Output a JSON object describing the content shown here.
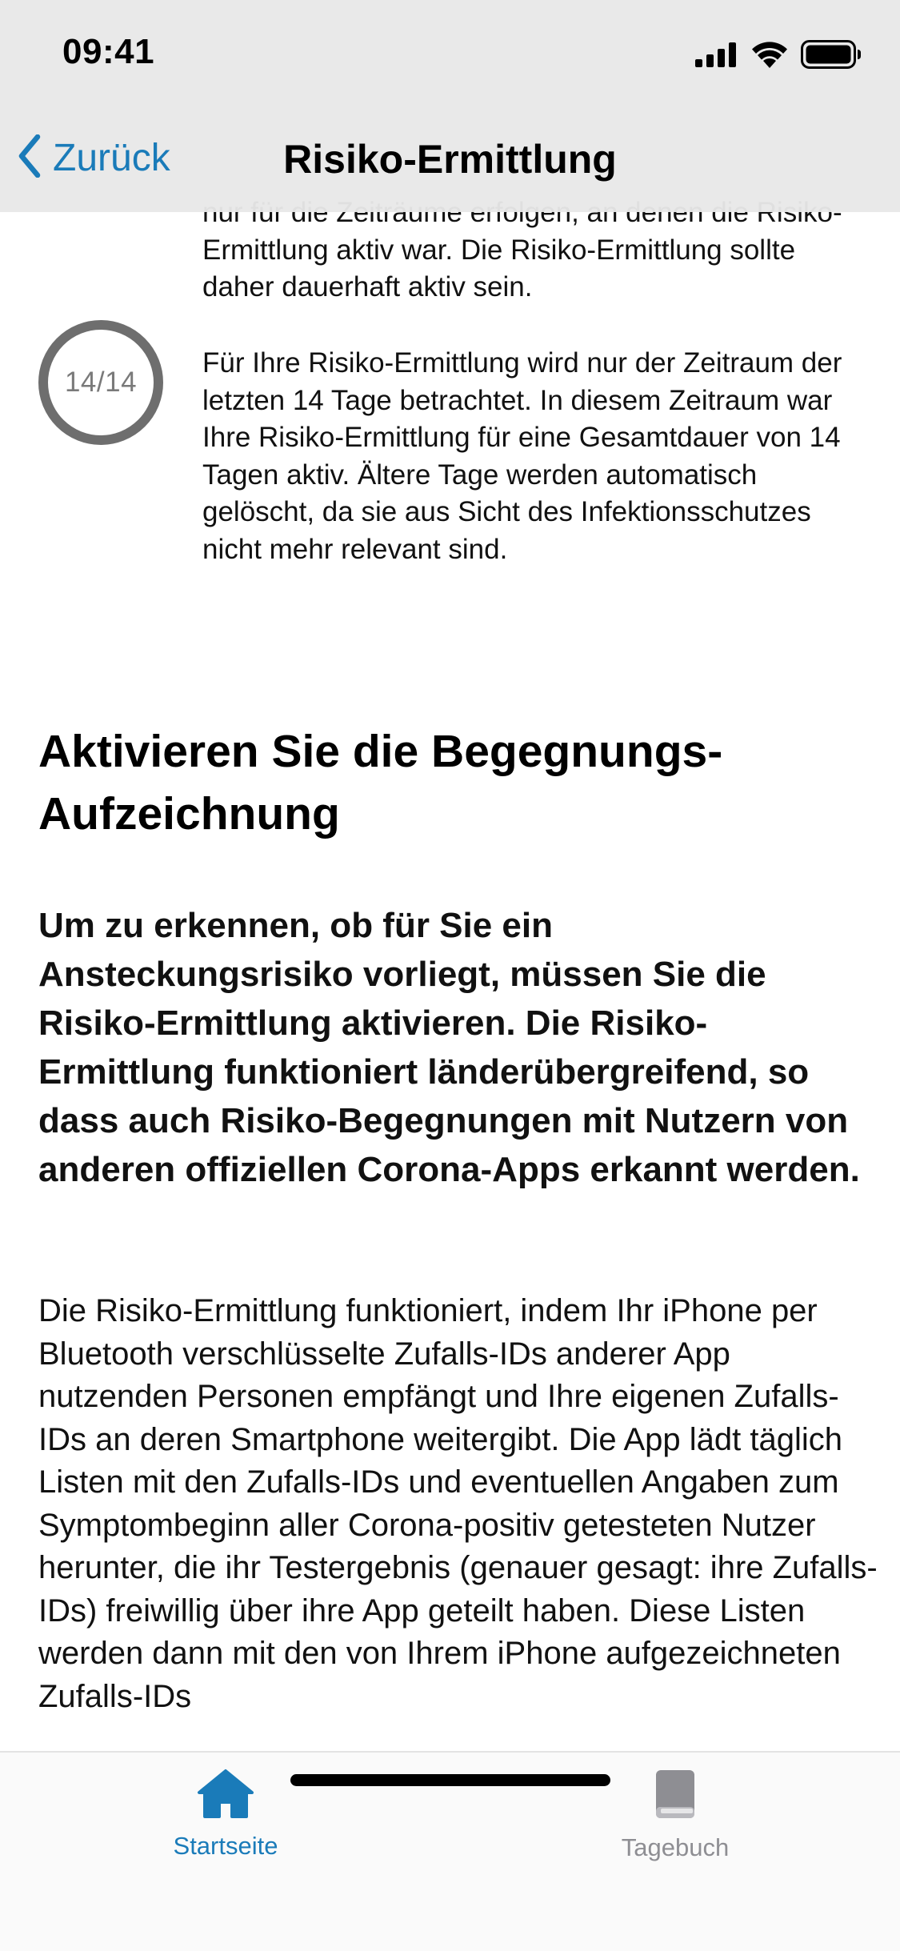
{
  "status_bar": {
    "time": "09:41"
  },
  "nav": {
    "back_label": "Zurück",
    "title": "Risiko-Ermittlung"
  },
  "info": {
    "partial_text": "nur für die Zeiträume erfolgen, an denen die Risiko-Ermittlung aktiv war. Die Risiko-Ermittlung sollte daher dauerhaft aktiv sein.",
    "ring_label": "14/14",
    "active_days": 14,
    "total_days": 14,
    "period_text": "Für Ihre Risiko-Ermittlung wird nur der Zeitraum der letzten 14 Tage betrachtet. In diesem Zeitraum war Ihre Risiko-Ermittlung für eine Gesamtdauer von 14 Tagen aktiv. Ältere Tage werden automatisch gelöscht, da sie aus Sicht des Infektionsschutzes nicht mehr relevant sind."
  },
  "section": {
    "headline": "Aktivieren Sie die Begegnungs-Aufzeichnung",
    "subheadline": "Um zu erkennen, ob für Sie ein Ansteckungsrisiko vorliegt, müssen Sie die Risiko-Ermittlung aktivieren. Die Risiko-Ermittlung funktioniert länderübergreifend, so dass auch Risiko-Begegnungen mit Nutzern von anderen offiziellen Corona-Apps erkannt werden.",
    "body": "Die Risiko-Ermittlung funktioniert, indem Ihr iPhone per Bluetooth verschlüsselte Zufalls-IDs anderer App nutzenden Personen empfängt und Ihre eigenen Zufalls-IDs an deren Smartphone weitergibt. Die App lädt täglich Listen mit den Zufalls-IDs und eventuellen Angaben zum Symptombeginn aller Corona-positiv getesteten Nutzer herunter, die ihr Testergebnis (genauer gesagt: ihre Zufalls-IDs) freiwillig über ihre App geteilt haben. Diese Listen werden dann mit den von Ihrem iPhone aufgezeichneten Zufalls-IDs"
  },
  "tabbar": {
    "tabs": [
      {
        "label": "Startseite",
        "icon": "house-icon",
        "active": true
      },
      {
        "label": "Tagebuch",
        "icon": "book-icon",
        "active": false
      }
    ]
  },
  "colors": {
    "accent": "#1a7bb9",
    "ring": "#6e6e6e",
    "inactive_tab": "#8e8e93"
  }
}
